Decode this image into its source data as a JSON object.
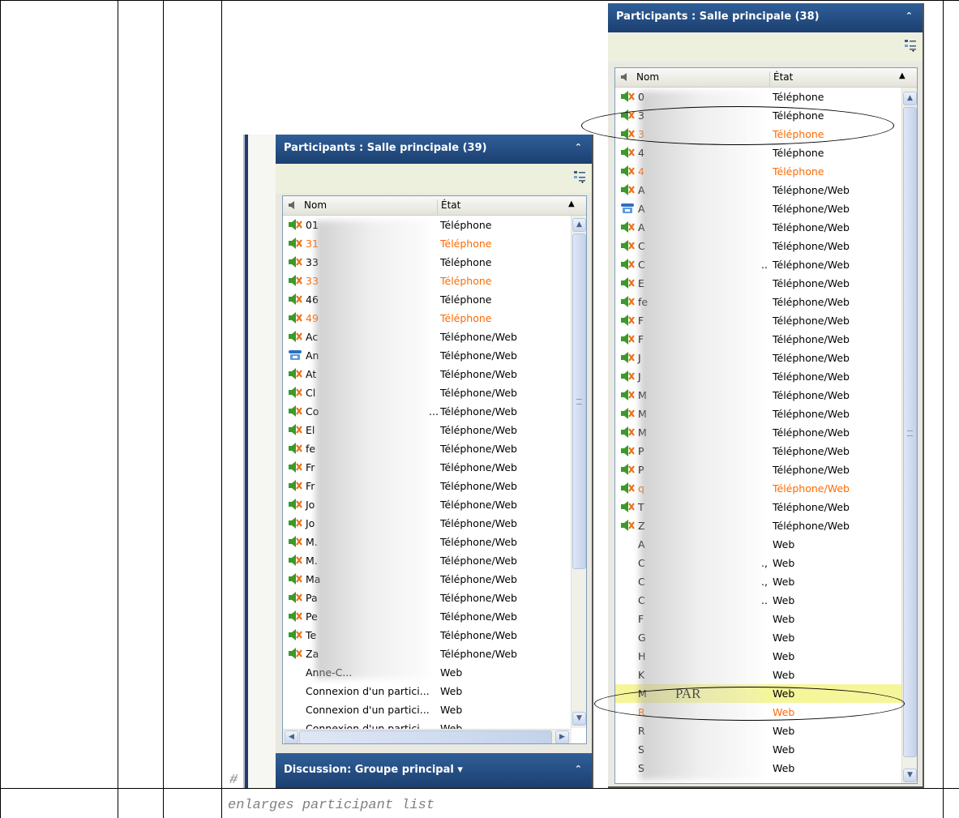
{
  "caption": {
    "hash": "#",
    "text": "enlarges participant list"
  },
  "left_panel": {
    "title": "Participants : Salle principale (39)",
    "header": {
      "nom": "Nom",
      "etat": "État"
    },
    "rows": [
      {
        "name": "01",
        "state": "Téléphone",
        "icon": "speaker-icon",
        "orange": false
      },
      {
        "name": "31",
        "state": "Téléphone",
        "icon": "speaker-icon",
        "orange": true
      },
      {
        "name": "33",
        "state": "Téléphone",
        "icon": "speaker-icon",
        "orange": false
      },
      {
        "name": "33",
        "state": "Téléphone",
        "icon": "speaker-icon",
        "orange": true
      },
      {
        "name": "46",
        "state": "Téléphone",
        "icon": "speaker-icon",
        "orange": false
      },
      {
        "name": "49",
        "state": "Téléphone",
        "icon": "speaker-icon",
        "orange": true
      },
      {
        "name": "Ac",
        "state": "Téléphone/Web",
        "icon": "speaker-icon",
        "orange": false
      },
      {
        "name": "An",
        "state": "Téléphone/Web",
        "icon": "phone-icon",
        "orange": false
      },
      {
        "name": "At",
        "state": "Téléphone/Web",
        "icon": "speaker-icon",
        "orange": false
      },
      {
        "name": "Cl",
        "state": "Téléphone/Web",
        "icon": "speaker-icon",
        "orange": false
      },
      {
        "name": "Co",
        "state": "Téléphone/Web",
        "icon": "speaker-icon",
        "orange": false,
        "ellipsis": "..."
      },
      {
        "name": "El",
        "state": "Téléphone/Web",
        "icon": "speaker-icon",
        "orange": false
      },
      {
        "name": "fe",
        "state": "Téléphone/Web",
        "icon": "speaker-icon",
        "orange": false
      },
      {
        "name": "Fr",
        "state": "Téléphone/Web",
        "icon": "speaker-icon",
        "orange": false
      },
      {
        "name": "Fr",
        "state": "Téléphone/Web",
        "icon": "speaker-icon",
        "orange": false
      },
      {
        "name": "Jo",
        "state": "Téléphone/Web",
        "icon": "speaker-icon",
        "orange": false
      },
      {
        "name": "Jo",
        "state": "Téléphone/Web",
        "icon": "speaker-icon",
        "orange": false
      },
      {
        "name": "M.",
        "state": "Téléphone/Web",
        "icon": "speaker-icon",
        "orange": false
      },
      {
        "name": "M.",
        "state": "Téléphone/Web",
        "icon": "speaker-icon",
        "orange": false
      },
      {
        "name": "Ma",
        "state": "Téléphone/Web",
        "icon": "speaker-icon",
        "orange": false
      },
      {
        "name": "Pa",
        "state": "Téléphone/Web",
        "icon": "speaker-icon",
        "orange": false
      },
      {
        "name": "Pe",
        "state": "Téléphone/Web",
        "icon": "speaker-icon",
        "orange": false
      },
      {
        "name": "Te",
        "state": "Téléphone/Web",
        "icon": "speaker-icon",
        "orange": false
      },
      {
        "name": "Za",
        "state": "Téléphone/Web",
        "icon": "speaker-icon",
        "orange": false
      },
      {
        "name": "Anne-C...",
        "state": "Web",
        "icon": "",
        "orange": false
      },
      {
        "name": "Connexion d'un partici...",
        "state": "Web",
        "icon": "",
        "orange": false
      },
      {
        "name": "Connexion d'un partici...",
        "state": "Web",
        "icon": "",
        "orange": false
      },
      {
        "name": "Connexion d'un partici...",
        "state": "Web",
        "icon": "",
        "orange": false
      }
    ],
    "discussion_title": "Discussion: Groupe principal ▾"
  },
  "right_panel": {
    "title": "Participants : Salle principale (38)",
    "header": {
      "nom": "Nom",
      "etat": "État"
    },
    "rows": [
      {
        "name": "0",
        "state": "Téléphone",
        "icon": "speaker-icon",
        "orange": false
      },
      {
        "name": "3",
        "state": "Téléphone",
        "icon": "speaker-icon",
        "orange": false
      },
      {
        "name": "3",
        "state": "Téléphone",
        "icon": "speaker-icon",
        "orange": true
      },
      {
        "name": "4",
        "state": "Téléphone",
        "icon": "speaker-icon",
        "orange": false
      },
      {
        "name": "4",
        "state": "Téléphone",
        "icon": "speaker-icon",
        "orange": true
      },
      {
        "name": "A",
        "state": "Téléphone/Web",
        "icon": "speaker-icon",
        "orange": false
      },
      {
        "name": "A",
        "state": "Téléphone/Web",
        "icon": "phone-icon",
        "orange": false
      },
      {
        "name": "A",
        "state": "Téléphone/Web",
        "icon": "speaker-icon",
        "orange": false
      },
      {
        "name": "C",
        "state": "Téléphone/Web",
        "icon": "speaker-icon",
        "orange": false
      },
      {
        "name": "C",
        "state": "Téléphone/Web",
        "icon": "speaker-icon",
        "orange": false,
        "ellipsis": ".."
      },
      {
        "name": "E",
        "state": "Téléphone/Web",
        "icon": "speaker-icon",
        "orange": false
      },
      {
        "name": "fe",
        "state": "Téléphone/Web",
        "icon": "speaker-icon",
        "orange": false
      },
      {
        "name": "F",
        "state": "Téléphone/Web",
        "icon": "speaker-icon",
        "orange": false
      },
      {
        "name": "F",
        "state": "Téléphone/Web",
        "icon": "speaker-icon",
        "orange": false
      },
      {
        "name": "J",
        "state": "Téléphone/Web",
        "icon": "speaker-icon",
        "orange": false
      },
      {
        "name": "J",
        "state": "Téléphone/Web",
        "icon": "speaker-icon",
        "orange": false
      },
      {
        "name": "M",
        "state": "Téléphone/Web",
        "icon": "speaker-icon",
        "orange": false
      },
      {
        "name": "M",
        "state": "Téléphone/Web",
        "icon": "speaker-icon",
        "orange": false
      },
      {
        "name": "M",
        "state": "Téléphone/Web",
        "icon": "speaker-icon",
        "orange": false
      },
      {
        "name": "P",
        "state": "Téléphone/Web",
        "icon": "speaker-icon",
        "orange": false
      },
      {
        "name": "P",
        "state": "Téléphone/Web",
        "icon": "speaker-icon",
        "orange": false
      },
      {
        "name": "q",
        "state": "Téléphone/Web",
        "icon": "speaker-icon",
        "orange": true
      },
      {
        "name": "T",
        "state": "Téléphone/Web",
        "icon": "speaker-icon",
        "orange": false
      },
      {
        "name": "Z",
        "state": "Téléphone/Web",
        "icon": "speaker-icon",
        "orange": false
      },
      {
        "name": "A",
        "state": "Web",
        "icon": "",
        "orange": false
      },
      {
        "name": "C",
        "state": "Web",
        "icon": "",
        "orange": false,
        "ellipsis": ".,"
      },
      {
        "name": "C",
        "state": "Web",
        "icon": "",
        "orange": false,
        "ellipsis": ".,"
      },
      {
        "name": "C",
        "state": "Web",
        "icon": "",
        "orange": false,
        "ellipsis": ".."
      },
      {
        "name": "F",
        "state": "Web",
        "icon": "",
        "orange": false
      },
      {
        "name": "G",
        "state": "Web",
        "icon": "",
        "orange": false
      },
      {
        "name": "H",
        "state": "Web",
        "icon": "",
        "orange": false
      },
      {
        "name": "K",
        "state": "Web",
        "icon": "",
        "orange": false
      },
      {
        "name": "M",
        "state": "Web",
        "icon": "",
        "orange": false,
        "highlight": true,
        "tag": "PAR"
      },
      {
        "name": "R",
        "state": "Web",
        "icon": "",
        "orange": true
      },
      {
        "name": "R",
        "state": "Web",
        "icon": "",
        "orange": false
      },
      {
        "name": "S",
        "state": "Web",
        "icon": "",
        "orange": false
      },
      {
        "name": "S",
        "state": "Web",
        "icon": "",
        "orange": false
      }
    ]
  },
  "colors": {
    "title_bar": "#1f4478",
    "orange_text": "#ff6a00",
    "highlight": "#f5f59a"
  }
}
